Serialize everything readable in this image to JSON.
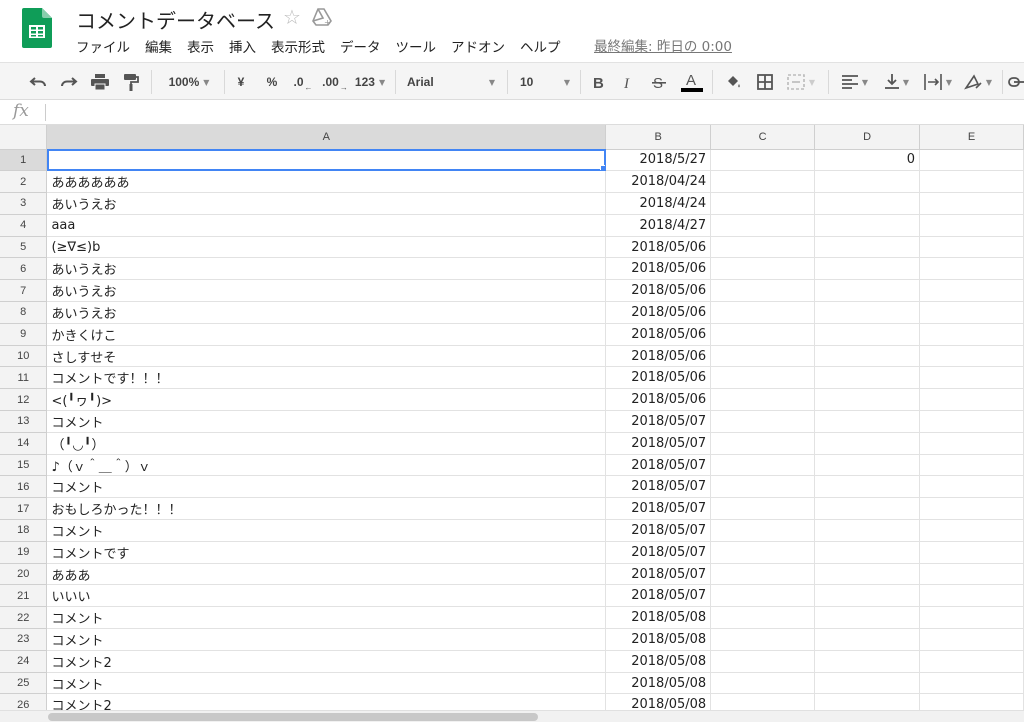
{
  "header": {
    "title": "コメントデータベース",
    "last_edit": "最終編集: 昨日の 0:00",
    "menu": [
      "ファイル",
      "編集",
      "表示",
      "挿入",
      "表示形式",
      "データ",
      "ツール",
      "アドオン",
      "ヘルプ"
    ]
  },
  "toolbar": {
    "zoom": "100%",
    "currency": "¥",
    "percent": "%",
    "decimal_decrease": ".0",
    "decimal_increase": ".00",
    "more_formats": "123",
    "font": "Arial",
    "font_size": "10",
    "underline_color": "#000000"
  },
  "formula_bar": {
    "fx": "fx",
    "value": ""
  },
  "sheet": {
    "columns": [
      "A",
      "B",
      "C",
      "D",
      "E"
    ],
    "selected_cell": "A1",
    "rows": [
      {
        "num": "1",
        "a": "",
        "b": "2018/5/27",
        "c": "",
        "d": "0",
        "e": ""
      },
      {
        "num": "2",
        "a": "ああああああ",
        "b": "2018/04/24",
        "c": "",
        "d": "",
        "e": ""
      },
      {
        "num": "3",
        "a": "あいうえお",
        "b": "2018/4/24",
        "c": "",
        "d": "",
        "e": ""
      },
      {
        "num": "4",
        "a": "aaa",
        "b": "2018/4/27",
        "c": "",
        "d": "",
        "e": ""
      },
      {
        "num": "5",
        "a": "(≥∇≤)b",
        "b": "2018/05/06",
        "c": "",
        "d": "",
        "e": ""
      },
      {
        "num": "6",
        "a": "あいうえお",
        "b": "2018/05/06",
        "c": "",
        "d": "",
        "e": ""
      },
      {
        "num": "7",
        "a": "あいうえお",
        "b": "2018/05/06",
        "c": "",
        "d": "",
        "e": ""
      },
      {
        "num": "8",
        "a": "あいうえお",
        "b": "2018/05/06",
        "c": "",
        "d": "",
        "e": ""
      },
      {
        "num": "9",
        "a": "かきくけこ",
        "b": "2018/05/06",
        "c": "",
        "d": "",
        "e": ""
      },
      {
        "num": "10",
        "a": "さしすせそ",
        "b": "2018/05/06",
        "c": "",
        "d": "",
        "e": ""
      },
      {
        "num": "11",
        "a": "コメントです！！！",
        "b": "2018/05/06",
        "c": "",
        "d": "",
        "e": ""
      },
      {
        "num": "12",
        "a": "<(╹ヮ╹)>",
        "b": "2018/05/06",
        "c": "",
        "d": "",
        "e": ""
      },
      {
        "num": "13",
        "a": "コメント",
        "b": "2018/05/07",
        "c": "",
        "d": "",
        "e": ""
      },
      {
        "num": "14",
        "a": "（╹◡╹）",
        "b": "2018/05/07",
        "c": "",
        "d": "",
        "e": ""
      },
      {
        "num": "15",
        "a": "♪（ｖ＾＿＾）ｖ",
        "b": "2018/05/07",
        "c": "",
        "d": "",
        "e": ""
      },
      {
        "num": "16",
        "a": "コメント",
        "b": "2018/05/07",
        "c": "",
        "d": "",
        "e": ""
      },
      {
        "num": "17",
        "a": "おもしろかった！！！",
        "b": "2018/05/07",
        "c": "",
        "d": "",
        "e": ""
      },
      {
        "num": "18",
        "a": "コメント",
        "b": "2018/05/07",
        "c": "",
        "d": "",
        "e": ""
      },
      {
        "num": "19",
        "a": "コメントです",
        "b": "2018/05/07",
        "c": "",
        "d": "",
        "e": ""
      },
      {
        "num": "20",
        "a": "あああ",
        "b": "2018/05/07",
        "c": "",
        "d": "",
        "e": ""
      },
      {
        "num": "21",
        "a": "いいい",
        "b": "2018/05/07",
        "c": "",
        "d": "",
        "e": ""
      },
      {
        "num": "22",
        "a": "コメント",
        "b": "2018/05/08",
        "c": "",
        "d": "",
        "e": ""
      },
      {
        "num": "23",
        "a": "コメント",
        "b": "2018/05/08",
        "c": "",
        "d": "",
        "e": ""
      },
      {
        "num": "24",
        "a": "コメント2",
        "b": "2018/05/08",
        "c": "",
        "d": "",
        "e": ""
      },
      {
        "num": "25",
        "a": "コメント",
        "b": "2018/05/08",
        "c": "",
        "d": "",
        "e": ""
      },
      {
        "num": "26",
        "a": "コメント2",
        "b": "2018/05/08",
        "c": "",
        "d": "",
        "e": ""
      }
    ]
  },
  "colors": {
    "logo_green": "#0f9d58",
    "selection_blue": "#4285f4"
  }
}
